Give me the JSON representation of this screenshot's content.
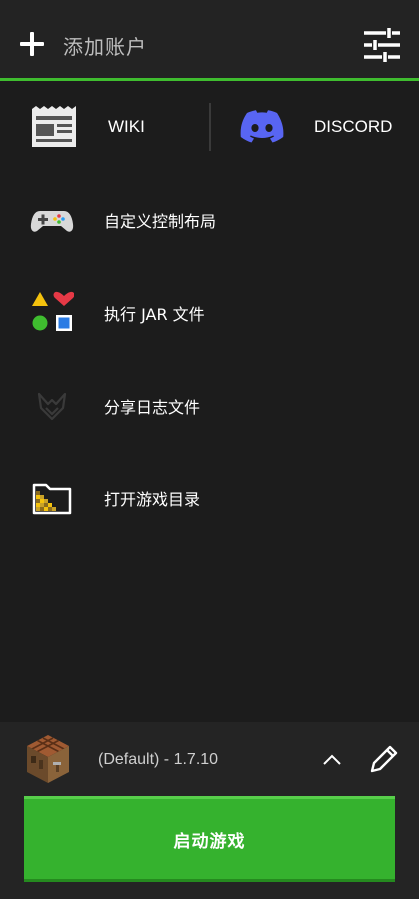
{
  "header": {
    "add_account_label": "添加账户",
    "add_icon": "plus-icon",
    "settings_icon": "sliders-icon"
  },
  "links": [
    {
      "label": "WIKI",
      "icon": "wiki-page-icon"
    },
    {
      "label": "DISCORD",
      "icon": "discord-icon"
    }
  ],
  "menu": [
    {
      "label": "自定义控制布局",
      "icon": "gamepad-icon"
    },
    {
      "label": "执行 JAR 文件",
      "icon": "shapes-icon"
    },
    {
      "label": "分享日志文件",
      "icon": "log-share-icon"
    },
    {
      "label": "打开游戏目录",
      "icon": "folder-icon"
    }
  ],
  "profile": {
    "label": "(Default) - 1.7.10",
    "icon": "crafting-table-icon"
  },
  "launch": {
    "label": "启动游戏"
  },
  "colors": {
    "accent": "#3fbd2f",
    "button": "#35b22e",
    "background": "#1c1c1c",
    "discord": "#5865f2"
  }
}
